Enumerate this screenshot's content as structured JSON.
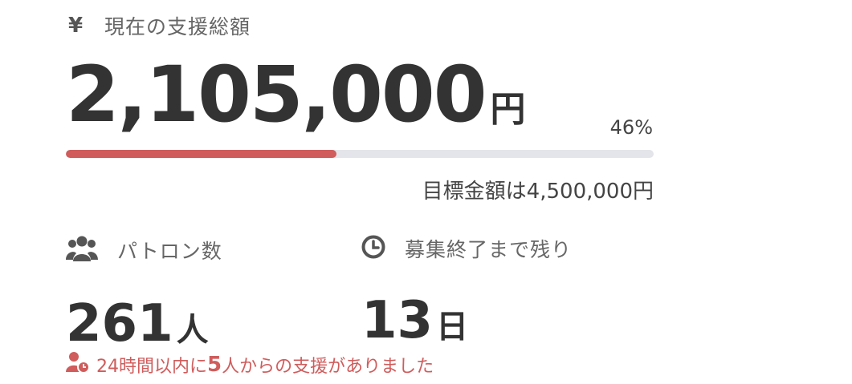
{
  "total": {
    "label": "現在の支援総額",
    "amount": "2,105,000",
    "unit": "円",
    "percent_text": "46%",
    "progress": 0.46,
    "goal_text": "目標金額は4,500,000円"
  },
  "patrons": {
    "label": "パトロン数",
    "value": "261",
    "unit": "人"
  },
  "remaining": {
    "label": "募集終了まで残り",
    "value": "13",
    "unit": "日"
  },
  "recent": {
    "prefix": "24時間以内に",
    "count": "5",
    "suffix": "人からの支援がありました"
  },
  "icons": {
    "total": "yen-icon",
    "patrons": "users-icon",
    "remaining": "clock-icon",
    "recent": "user-clock-icon"
  },
  "colors": {
    "accent": "#d05c5c",
    "track": "#e4e5ea",
    "text": "#333333"
  }
}
